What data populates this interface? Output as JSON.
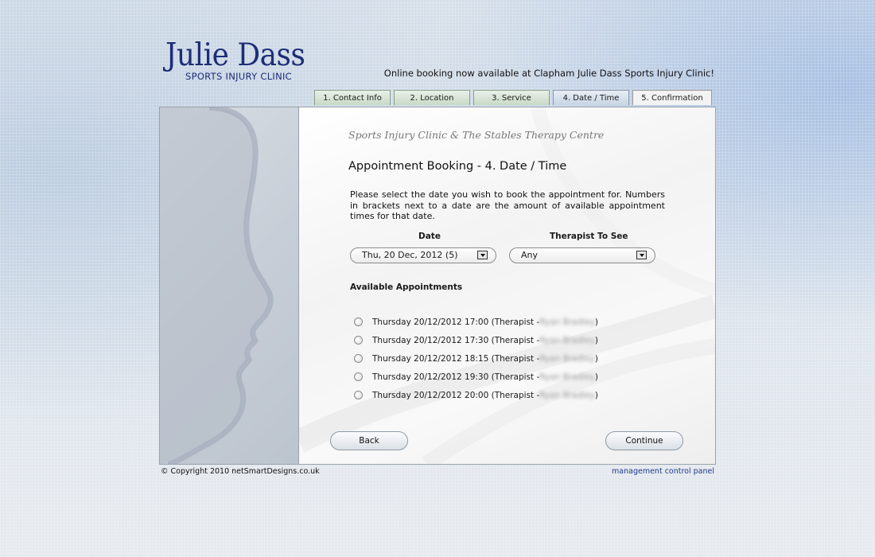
{
  "brand": {
    "name": "Julie Dass",
    "subtitle": "SPORTS INJURY CLINIC"
  },
  "header": {
    "announcement": "Online booking now available at Clapham Julie Dass Sports Injury Clinic!"
  },
  "tabs": [
    {
      "label": "1. Contact Info"
    },
    {
      "label": "2. Location"
    },
    {
      "label": "3. Service"
    },
    {
      "label": "4. Date / Time"
    },
    {
      "label": "5. Confirmation"
    }
  ],
  "main": {
    "clinic_title": "Sports Injury Clinic & The Stables Therapy Centre",
    "heading": "Appointment Booking - 4. Date / Time",
    "intro": "Please select the date you wish to book the appointment for. Numbers in brackets next to a date are the amount of available appointment times for that date.",
    "date_label": "Date",
    "date_value": "Thu, 20 Dec, 2012 (5)",
    "therapist_label": "Therapist To See",
    "therapist_value": "Any",
    "available_heading": "Available Appointments",
    "appointments": [
      {
        "text": "Thursday 20/12/2012 17:00 (Therapist - ",
        "therapist": "Ryan Bradley",
        "close": ")"
      },
      {
        "text": "Thursday 20/12/2012 17:30 (Therapist - ",
        "therapist": "Ryan Bradley",
        "close": ")"
      },
      {
        "text": "Thursday 20/12/2012 18:15 (Therapist - ",
        "therapist": "Ryan Bradley",
        "close": ")"
      },
      {
        "text": "Thursday 20/12/2012 19:30 (Therapist - ",
        "therapist": "Ryan Bradley",
        "close": ")"
      },
      {
        "text": "Thursday 20/12/2012 20:00 (Therapist - ",
        "therapist": "Ryan Bradley",
        "close": ")"
      }
    ],
    "back_label": "Back",
    "continue_label": "Continue"
  },
  "footer": {
    "copyright": "© Copyright 2010 netSmartDesigns.co.uk",
    "admin_link": "management control panel"
  },
  "colors": {
    "brand": "#1d2d77",
    "tab_green": "#c9d9c6",
    "link": "#1f3a8a"
  }
}
